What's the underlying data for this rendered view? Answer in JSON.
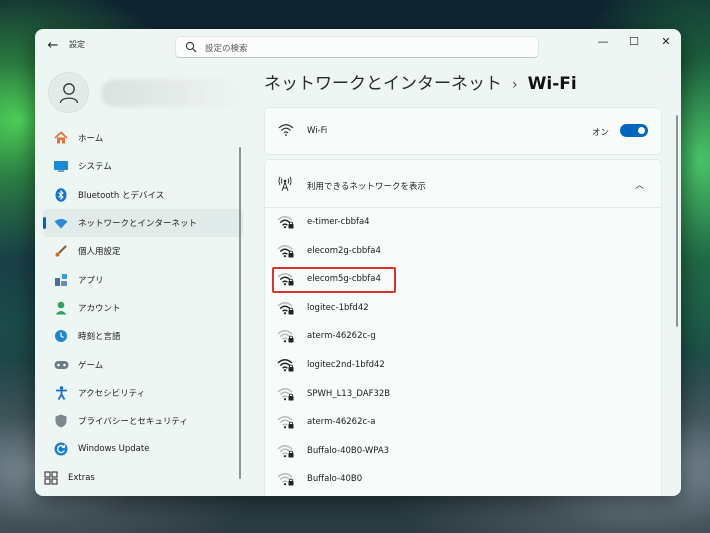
{
  "window": {
    "app_title": "設定",
    "search_placeholder": "設定の検索",
    "controls": [
      "—",
      "☐",
      "✕"
    ]
  },
  "sidebar": {
    "items": [
      {
        "label": "ホーム",
        "icon": "home-icon",
        "color": "#e5703b"
      },
      {
        "label": "システム",
        "icon": "system-icon",
        "color": "#1a8ad4"
      },
      {
        "label": "Bluetooth とデバイス",
        "icon": "bluetooth-icon",
        "color": "#1273d4"
      },
      {
        "label": "ネットワークとインターネット",
        "icon": "network-icon",
        "color": "#2c8ad8",
        "active": true
      },
      {
        "label": "個人用設定",
        "icon": "brush-icon",
        "color": "#d46a2a"
      },
      {
        "label": "アプリ",
        "icon": "apps-icon",
        "color": "#4a6ea0"
      },
      {
        "label": "アカウント",
        "icon": "account-icon",
        "color": "#2aa360"
      },
      {
        "label": "時刻と言語",
        "icon": "clock-globe-icon",
        "color": "#1f86c9"
      },
      {
        "label": "ゲーム",
        "icon": "gamepad-icon",
        "color": "#6b7a88"
      },
      {
        "label": "アクセシビリティ",
        "icon": "accessibility-icon",
        "color": "#1a6fd0"
      },
      {
        "label": "プライバシーとセキュリティ",
        "icon": "shield-icon",
        "color": "#7c8790"
      },
      {
        "label": "Windows Update",
        "icon": "update-icon",
        "color": "#1a7fd0"
      },
      {
        "label": "Extras",
        "icon": "extras-icon",
        "color": "#333333"
      }
    ]
  },
  "main": {
    "breadcrumb_parent": "ネットワークとインターネット",
    "breadcrumb_sep": "›",
    "breadcrumb_current": "Wi-Fi",
    "wifi_label": "Wi-Fi",
    "wifi_state": "オン",
    "wifi_on": true,
    "available_label": "利用できるネットワークを表示",
    "networks": [
      {
        "name": "e-timer-cbbfa4",
        "signal": 3
      },
      {
        "name": "elecom2g-cbbfa4",
        "signal": 3
      },
      {
        "name": "elecom5g-cbbfa4",
        "signal": 3,
        "highlighted": true
      },
      {
        "name": "logitec-1bfd42",
        "signal": 3
      },
      {
        "name": "aterm-46262c-g",
        "signal": 1
      },
      {
        "name": "logitec2nd-1bfd42",
        "signal": 4
      },
      {
        "name": "SPWH_L13_DAF32B",
        "signal": 1
      },
      {
        "name": "aterm-46262c-a",
        "signal": 1
      },
      {
        "name": "Buffalo-40B0-WPA3",
        "signal": 1
      },
      {
        "name": "Buffalo-40B0",
        "signal": 1
      }
    ]
  },
  "colors": {
    "accent": "#0067c0",
    "highlight_border": "#e03030"
  }
}
